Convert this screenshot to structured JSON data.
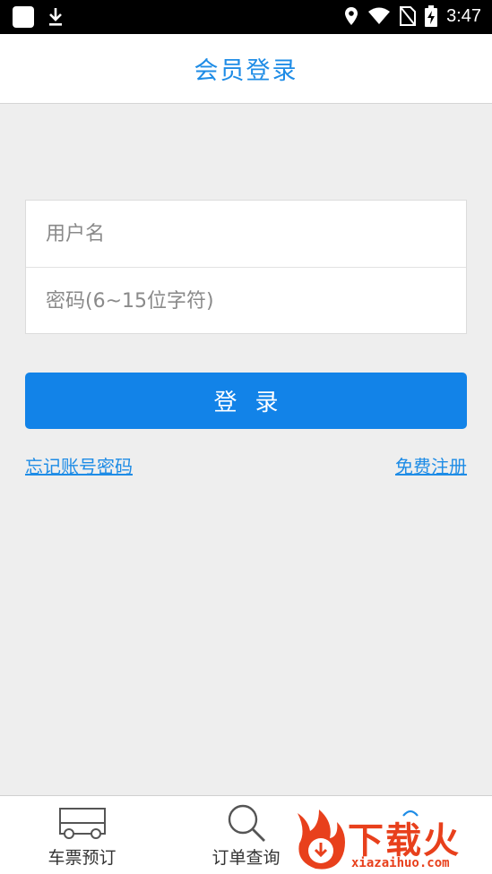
{
  "status_bar": {
    "time": "3:47"
  },
  "header": {
    "title": "会员登录"
  },
  "form": {
    "username_placeholder": "用户名",
    "password_placeholder": "密码(6~15位字符)"
  },
  "login_button": {
    "label": "登录"
  },
  "links": {
    "forgot": "忘记账号密码",
    "register": "免费注册"
  },
  "tabs": [
    {
      "label": "车票预订",
      "icon": "bus-icon"
    },
    {
      "label": "订单查询",
      "icon": "search-icon"
    }
  ],
  "watermark": {
    "text": "下载火",
    "url": "xiazaihuo.com"
  },
  "colors": {
    "accent": "#1283e8",
    "link": "#1e8ce6",
    "background": "#eeeeee",
    "watermark": "#e8401c"
  }
}
